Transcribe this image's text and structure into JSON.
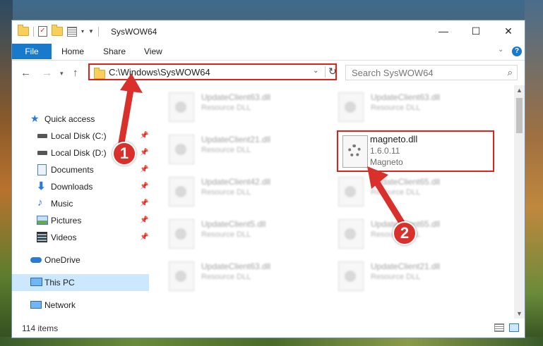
{
  "window": {
    "title": "SysWOW64",
    "controls": {
      "minimize": "—",
      "maximize": "☐",
      "close": "✕"
    }
  },
  "ribbon": {
    "tabs": [
      "File",
      "Home",
      "Share",
      "View"
    ],
    "help": "?"
  },
  "navigation": {
    "back": "←",
    "forward": "→",
    "up": "↑",
    "address": "C:\\Windows\\SysWOW64",
    "search_placeholder": "Search SysWOW64"
  },
  "sidebar": {
    "items": [
      {
        "label": "Quick access",
        "icon": "star-icon",
        "pinned": false
      },
      {
        "label": "Local Disk (C:)",
        "icon": "drive-icon",
        "pinned": true
      },
      {
        "label": "Local Disk (D:)",
        "icon": "drive-icon",
        "pinned": true
      },
      {
        "label": "Documents",
        "icon": "documents-icon",
        "pinned": true
      },
      {
        "label": "Downloads",
        "icon": "download-icon",
        "pinned": true
      },
      {
        "label": "Music",
        "icon": "music-icon",
        "pinned": true
      },
      {
        "label": "Pictures",
        "icon": "pictures-icon",
        "pinned": true
      },
      {
        "label": "Videos",
        "icon": "videos-icon",
        "pinned": true
      },
      {
        "label": "OneDrive",
        "icon": "cloud-icon",
        "pinned": false
      },
      {
        "label": "This PC",
        "icon": "computer-icon",
        "pinned": false,
        "selected": true
      },
      {
        "label": "Network",
        "icon": "network-icon",
        "pinned": false
      }
    ]
  },
  "files": {
    "blurred_left": [
      {
        "name": "UpdateClient63.dll",
        "type": "Resource DLL"
      },
      {
        "name": "UpdateClient21.dll",
        "type": "Resource DLL"
      },
      {
        "name": "UpdateClient42.dll",
        "type": "Resource DLL"
      },
      {
        "name": "UpdateClient5.dll",
        "type": "Resource DLL"
      },
      {
        "name": "UpdateClient63.dll",
        "type": "Resource DLL"
      }
    ],
    "blurred_right": [
      {
        "name": "UpdateClient63.dll",
        "type": "Resource DLL"
      },
      {
        "name": "UpdateClient65.dll",
        "type": "Resource DLL"
      },
      {
        "name": "UpdateClient65.dll",
        "type": "Resource DLL"
      },
      {
        "name": "UpdateClient21.dll",
        "type": "Resource DLL"
      }
    ],
    "highlighted": {
      "name": "magneto.dll",
      "version": "1.6.0.11",
      "description": "Magneto"
    }
  },
  "status": {
    "item_count": "114 items"
  },
  "annotations": {
    "step1": "1",
    "step2": "2",
    "color": "#d9302b"
  }
}
